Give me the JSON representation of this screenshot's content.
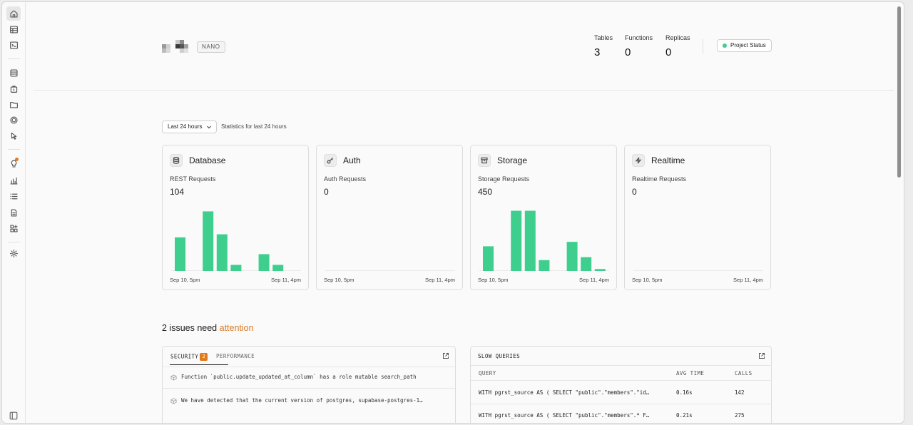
{
  "sidebar": {
    "items": [
      {
        "icon": "home-icon",
        "active": true
      },
      {
        "icon": "table-editor-icon"
      },
      {
        "icon": "sql-editor-icon"
      },
      {
        "icon": "database-icon"
      },
      {
        "icon": "auth-icon"
      },
      {
        "icon": "storage-icon"
      },
      {
        "icon": "edge-functions-icon"
      },
      {
        "icon": "realtime-icon"
      },
      {
        "icon": "advisors-icon"
      },
      {
        "icon": "reports-icon"
      },
      {
        "icon": "logs-icon"
      },
      {
        "icon": "api-docs-icon"
      },
      {
        "icon": "integrations-icon"
      },
      {
        "icon": "settings-icon"
      }
    ],
    "collapse_icon": "sidebar-toggle-icon"
  },
  "header": {
    "compute_badge": "NANO",
    "stats": [
      {
        "label": "Tables",
        "value": "3"
      },
      {
        "label": "Functions",
        "value": "0"
      },
      {
        "label": "Replicas",
        "value": "0"
      }
    ],
    "status_button": "Project Status",
    "status_color": "#3ecf8e"
  },
  "filters": {
    "range_label": "Last 24 hours",
    "range_description": "Statistics for last 24 hours"
  },
  "services": [
    {
      "title": "Database",
      "icon": "database-icon",
      "metric_label": "REST Requests",
      "metric_value": "104",
      "x_start": "Sep 10, 5pm",
      "x_end": "Sep 11, 4pm"
    },
    {
      "title": "Auth",
      "icon": "key-icon",
      "metric_label": "Auth Requests",
      "metric_value": "0",
      "x_start": "Sep 10, 5pm",
      "x_end": "Sep 11, 4pm"
    },
    {
      "title": "Storage",
      "icon": "archive-icon",
      "metric_label": "Storage Requests",
      "metric_value": "450",
      "x_start": "Sep 10, 5pm",
      "x_end": "Sep 11, 4pm"
    },
    {
      "title": "Realtime",
      "icon": "zap-icon",
      "metric_label": "Realtime Requests",
      "metric_value": "0",
      "x_start": "Sep 10, 5pm",
      "x_end": "Sep 11, 4pm"
    }
  ],
  "chart_data": [
    {
      "type": "bar",
      "title": "REST Requests",
      "bar_color": "#3ecf8e",
      "values": [
        22,
        0,
        39,
        24,
        4,
        0,
        11,
        4
      ],
      "ylim": [
        0,
        42
      ],
      "x": [
        "Sep 10, 5pm",
        "Sep 11, 4pm"
      ]
    },
    {
      "type": "bar",
      "title": "Auth Requests",
      "bar_color": "#3ecf8e",
      "values": [],
      "ylim": [
        0,
        42
      ],
      "x": [
        "Sep 10, 5pm",
        "Sep 11, 4pm"
      ]
    },
    {
      "type": "bar",
      "title": "Storage Requests",
      "bar_color": "#3ecf8e",
      "values": [
        50,
        0,
        122,
        122,
        22,
        0,
        59,
        28,
        4
      ],
      "ylim": [
        0,
        130
      ],
      "x": [
        "Sep 10, 5pm",
        "Sep 11, 4pm"
      ]
    },
    {
      "type": "bar",
      "title": "Realtime Requests",
      "bar_color": "#3ecf8e",
      "values": [],
      "ylim": [
        0,
        42
      ],
      "x": [
        "Sep 10, 5pm",
        "Sep 11, 4pm"
      ]
    }
  ],
  "issues": {
    "title_prefix": "2 issues need",
    "title_highlight": "attention",
    "highlight_color": "#d97a26",
    "tabs": [
      {
        "label": "SECURITY",
        "count": "2"
      },
      {
        "label": "PERFORMANCE"
      }
    ],
    "items": [
      "Function `public.update_updated_at_column` has a role mutable search_path",
      "We have detected that the current version of postgres, supabase-postgres-1…"
    ]
  },
  "slow_queries": {
    "title": "SLOW QUERIES",
    "columns": [
      "QUERY",
      "AVG TIME",
      "CALLS"
    ],
    "rows": [
      {
        "query": "WITH pgrst_source AS ( SELECT \"public\".\"members\".\"id…",
        "avg_time": "0.16s",
        "calls": "142"
      },
      {
        "query": "WITH pgrst_source AS ( SELECT \"public\".\"members\".* F…",
        "avg_time": "0.21s",
        "calls": "275"
      }
    ]
  }
}
